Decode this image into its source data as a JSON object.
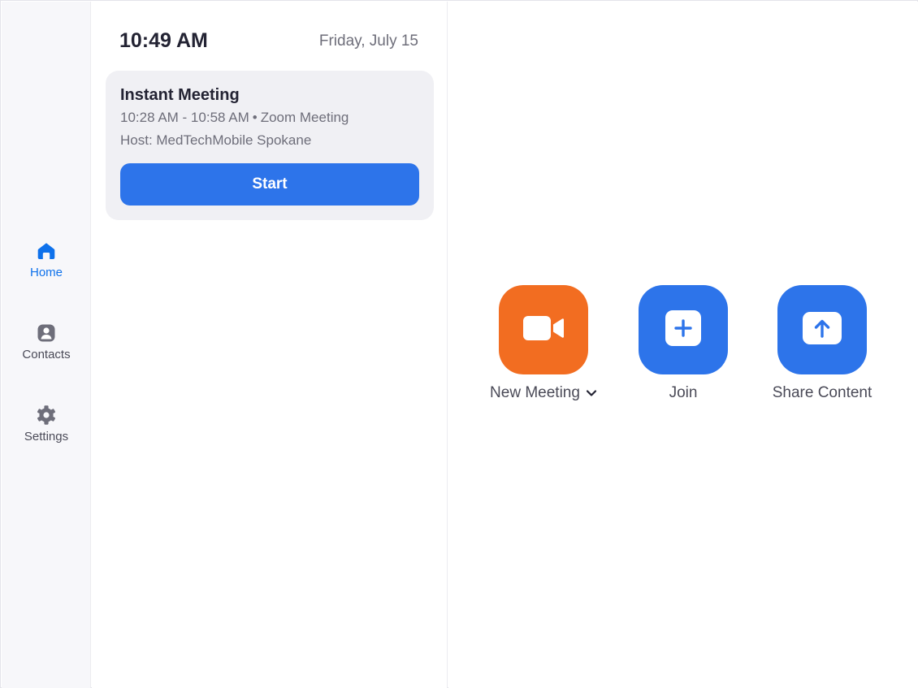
{
  "sidebar": {
    "items": [
      {
        "label": "Home",
        "icon": "home-icon",
        "active": true
      },
      {
        "label": "Contacts",
        "icon": "contacts-icon",
        "active": false
      },
      {
        "label": "Settings",
        "icon": "gear-icon",
        "active": false
      }
    ]
  },
  "header": {
    "time": "10:49 AM",
    "date": "Friday, July 15"
  },
  "meeting_card": {
    "title": "Instant Meeting",
    "time_range": "10:28 AM - 10:58 AM",
    "separator": "•",
    "meeting_type": "Zoom Meeting",
    "host": "Host: MedTechMobile Spokane",
    "start_label": "Start"
  },
  "actions": [
    {
      "label": "New Meeting",
      "icon": "video-camera-icon",
      "color": "#f26d21",
      "has_dropdown": true
    },
    {
      "label": "Join",
      "icon": "plus-icon",
      "color": "#2d74ea"
    },
    {
      "label": "Share Content",
      "icon": "upload-arrow-icon",
      "color": "#2d74ea"
    }
  ],
  "colors": {
    "accent": "#2d74ea",
    "active_nav": "#0e71eb",
    "new_meeting": "#f26d21"
  }
}
